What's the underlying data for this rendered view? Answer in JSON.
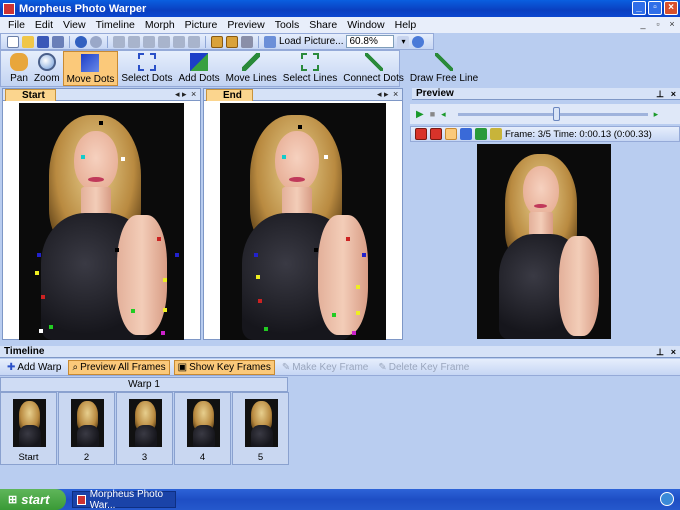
{
  "window": {
    "title": "Morpheus Photo Warper"
  },
  "menu": [
    "File",
    "Edit",
    "View",
    "Timeline",
    "Morph",
    "Picture",
    "Preview",
    "Tools",
    "Share",
    "Window",
    "Help"
  ],
  "toolbar1": {
    "load_picture_label": "Load Picture...",
    "zoom_value": "60.8%"
  },
  "toolbar2": {
    "tools": [
      {
        "label": "Pan",
        "icon": "hand-icon"
      },
      {
        "label": "Zoom",
        "icon": "magnifier-icon"
      },
      {
        "label": "Move Dots",
        "icon": "move-dots-icon",
        "active": true
      },
      {
        "label": "Select Dots",
        "icon": "select-dots-icon"
      },
      {
        "label": "Add Dots",
        "icon": "add-dots-icon"
      },
      {
        "label": "Move Lines",
        "icon": "move-lines-icon"
      },
      {
        "label": "Select Lines",
        "icon": "select-lines-icon"
      },
      {
        "label": "Connect Dots",
        "icon": "connect-dots-icon"
      },
      {
        "label": "Draw Free Line",
        "icon": "draw-line-icon"
      }
    ]
  },
  "panels": {
    "start": {
      "tab": "Start"
    },
    "end": {
      "tab": "End"
    },
    "preview": {
      "title": "Preview",
      "frame_info": "Frame: 3/5 Time: 0:00.13 (0:00.33)",
      "progress": 0.52
    }
  },
  "timeline": {
    "title": "Timeline",
    "buttons": [
      {
        "label": "Add Warp",
        "state": "normal"
      },
      {
        "label": "Preview All Frames",
        "state": "active"
      },
      {
        "label": "Show Key Frames",
        "state": "active"
      },
      {
        "label": "Make Key Frame",
        "state": "disabled"
      },
      {
        "label": "Delete Key Frame",
        "state": "disabled"
      }
    ],
    "warp_label": "Warp 1",
    "frames": [
      "Start",
      "2",
      "3",
      "4",
      "5"
    ]
  },
  "taskbar": {
    "start_label": "start",
    "task_item": "Morpheus Photo War..."
  },
  "colors": {
    "accent": "#fbc97a",
    "titlebar": "#0a4fd0",
    "taskbar": "#2558cc"
  }
}
